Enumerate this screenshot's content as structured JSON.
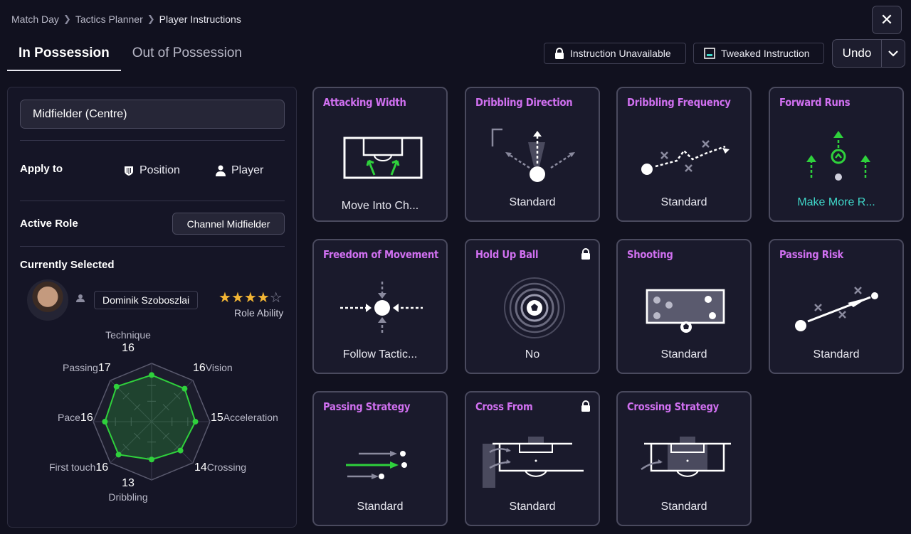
{
  "breadcrumb": {
    "items": [
      "Match Day",
      "Tactics Planner",
      "Player Instructions"
    ]
  },
  "close_icon": "close-icon",
  "tabs": [
    {
      "label": "In Possession",
      "active": true
    },
    {
      "label": "Out of Possession",
      "active": false
    }
  ],
  "legend": {
    "locked": "Instruction Unavailable",
    "tweaked": "Tweaked Instruction"
  },
  "undo": {
    "label": "Undo"
  },
  "panel": {
    "position": "Midfielder (Centre)",
    "apply_to": {
      "label": "Apply to",
      "options": [
        "Position",
        "Player"
      ]
    },
    "active_role": {
      "label": "Active Role",
      "value": "Channel Midfielder"
    },
    "selected": {
      "label": "Currently Selected",
      "player": "Dominik Szoboszlai",
      "rating": 4,
      "rating_max": 5,
      "rating_label": "Role Ability"
    },
    "attributes": [
      {
        "name": "Technique",
        "value": "16"
      },
      {
        "name": "Vision",
        "value": "16"
      },
      {
        "name": "Acceleration",
        "value": "15"
      },
      {
        "name": "Crossing",
        "value": "14"
      },
      {
        "name": "Dribbling",
        "value": "13"
      },
      {
        "name": "First touch",
        "value": "16"
      },
      {
        "name": "Pace",
        "value": "16"
      },
      {
        "name": "Passing",
        "value": "17"
      }
    ]
  },
  "instructions": [
    {
      "title": "Attacking Width",
      "value": "Move Into Ch...",
      "locked": false,
      "highlight": false,
      "icon": "pitch-width-icon"
    },
    {
      "title": "Dribbling Direction",
      "value": "Standard",
      "locked": false,
      "highlight": false,
      "icon": "dribble-direction-icon"
    },
    {
      "title": "Dribbling Frequency",
      "value": "Standard",
      "locked": false,
      "highlight": false,
      "icon": "dribble-frequency-icon"
    },
    {
      "title": "Forward Runs",
      "value": "Make More R...",
      "locked": false,
      "highlight": true,
      "icon": "forward-runs-icon"
    },
    {
      "title": "Freedom of Movement",
      "value": "Follow Tactic...",
      "locked": false,
      "highlight": false,
      "icon": "freedom-movement-icon"
    },
    {
      "title": "Hold Up Ball",
      "value": "No",
      "locked": true,
      "highlight": false,
      "icon": "hold-up-ball-icon"
    },
    {
      "title": "Shooting",
      "value": "Standard",
      "locked": false,
      "highlight": false,
      "icon": "shooting-icon"
    },
    {
      "title": "Passing Risk",
      "value": "Standard",
      "locked": false,
      "highlight": false,
      "icon": "passing-risk-icon"
    },
    {
      "title": "Passing Strategy",
      "value": "Standard",
      "locked": false,
      "highlight": false,
      "icon": "passing-strategy-icon"
    },
    {
      "title": "Cross From",
      "value": "Standard",
      "locked": true,
      "highlight": false,
      "icon": "cross-from-icon"
    },
    {
      "title": "Crossing Strategy",
      "value": "Standard",
      "locked": false,
      "highlight": false,
      "icon": "crossing-strategy-icon"
    }
  ],
  "colors": {
    "title_accent": "#d070f0",
    "highlight_value": "#3fd6c8",
    "radar_green": "#2fd13c",
    "star": "#f2b534"
  }
}
